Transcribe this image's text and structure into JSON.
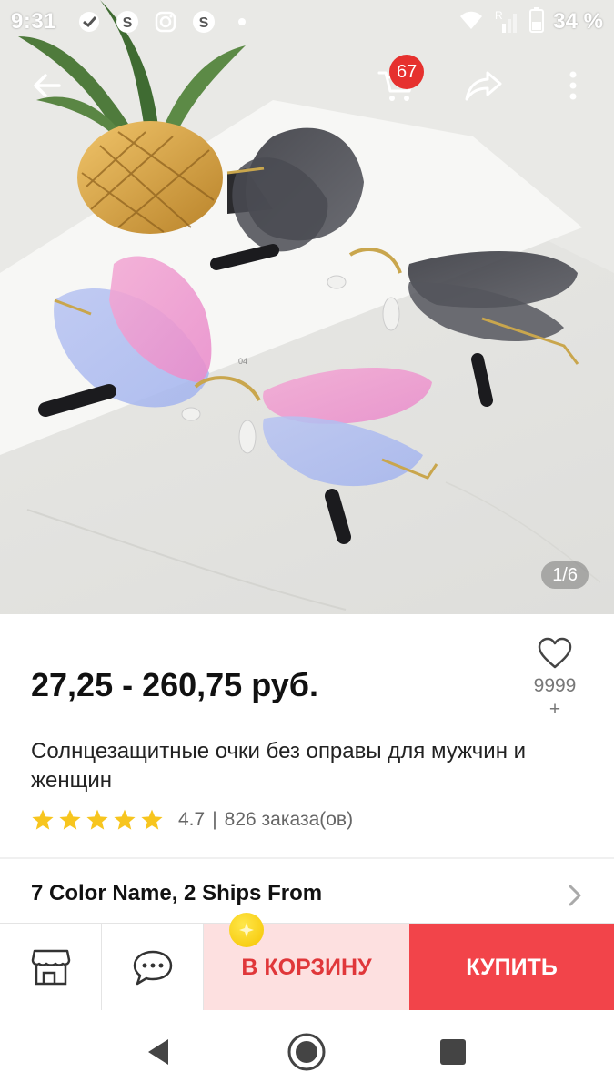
{
  "status_bar": {
    "time": "9:31",
    "signal_roaming": "R",
    "battery_text": "34 %",
    "left_icons": [
      "sberbank-icon",
      "skype-icon",
      "instagram-icon",
      "skype-icon",
      "dot-icon"
    ]
  },
  "top_bar": {
    "cart_badge": "67",
    "icons": [
      "back-arrow-icon",
      "cart-icon",
      "share-icon",
      "more-vert-icon"
    ]
  },
  "gallery": {
    "counter": "1/6",
    "print_label": "04"
  },
  "product": {
    "price": "27,25 - 260,75 руб.",
    "title": "Солнцезащитные очки без оправы для мужчин и женщин",
    "rating": "4.7",
    "rating_stars": 5,
    "rating_separator": "|",
    "orders": "826 заказа(ов)",
    "wishlist_count": "9999",
    "wishlist_plus": "+",
    "options_label": "7 Color Name, 2 Ships From"
  },
  "actions": {
    "add_to_cart": "В КОРЗИНУ",
    "buy": "КУПИТЬ"
  },
  "colors": {
    "accent_red": "#f2444a",
    "cart_bg": "#fde0e0",
    "cart_text": "#e0373a",
    "star": "#f7c51e",
    "badge": "#e6312e"
  }
}
